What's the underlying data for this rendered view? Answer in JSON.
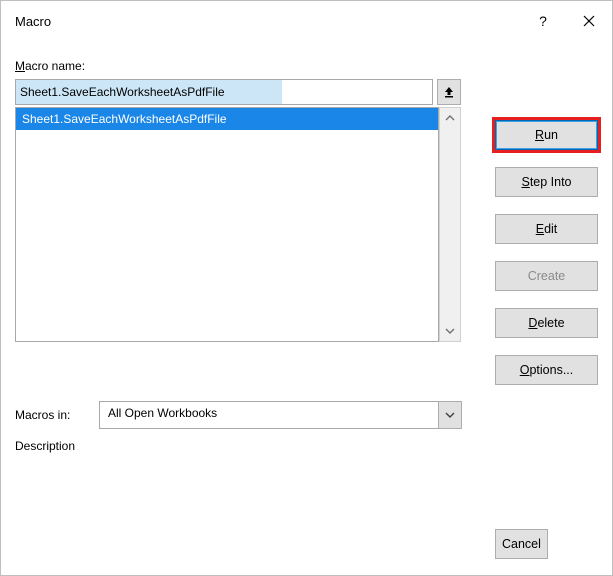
{
  "window": {
    "title": "Macro"
  },
  "labels": {
    "macro_name_pre": "M",
    "macro_name_post": "acro name:",
    "macros_in": "Macros in:",
    "description": "Description"
  },
  "inputs": {
    "macro_name_value": "Sheet1.SaveEachWorksheetAsPdfFile",
    "macros_in_value": "All Open Workbooks"
  },
  "list": {
    "items": [
      {
        "label": "Sheet1.SaveEachWorksheetAsPdfFile",
        "selected": true
      }
    ]
  },
  "buttons": {
    "run_pre": "R",
    "run_post": "un",
    "stepinto_pre": "S",
    "stepinto_post": "tep Into",
    "edit_pre": "E",
    "edit_post": "dit",
    "create": "Create",
    "delete_pre": "D",
    "delete_post": "elete",
    "options_pre": "O",
    "options_post": "ptions...",
    "cancel": "Cancel"
  }
}
